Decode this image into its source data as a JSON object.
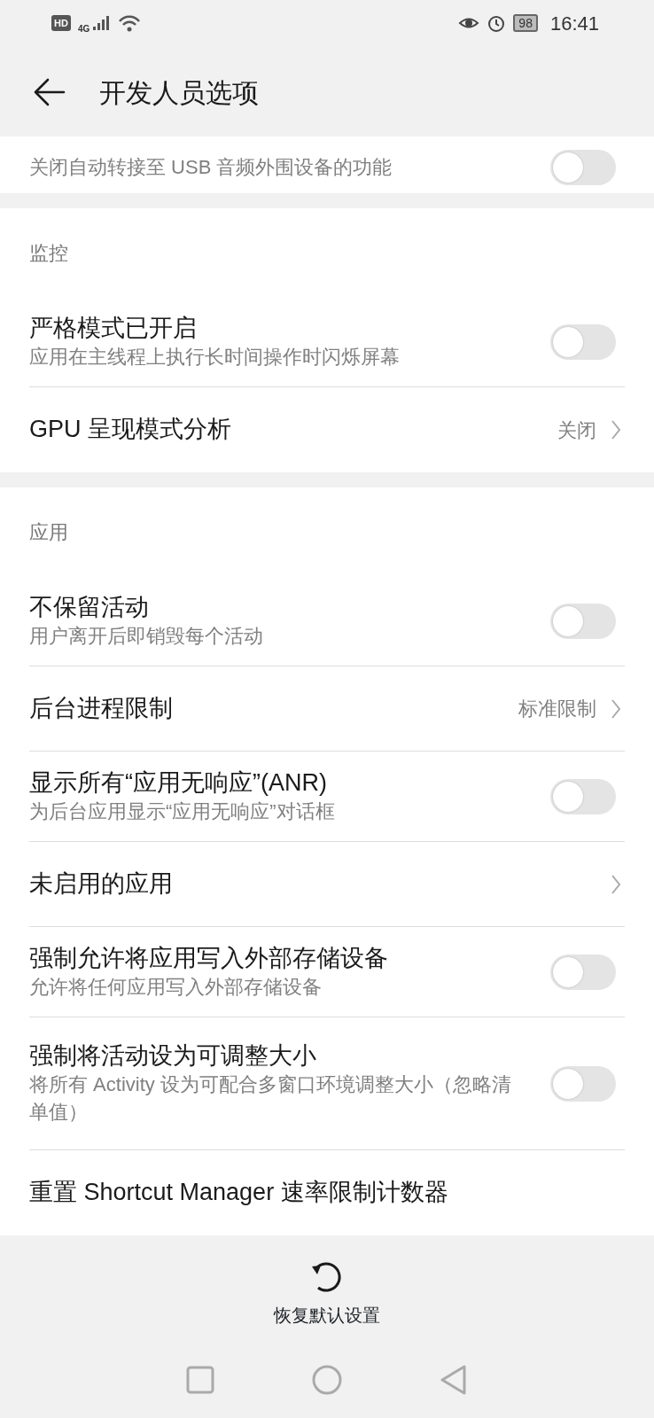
{
  "status_bar": {
    "hd": "HD",
    "network": "4G",
    "battery": "98",
    "time": "16:41"
  },
  "header": {
    "title": "开发人员选项"
  },
  "sections": [
    {
      "items": [
        {
          "kind": "toggle",
          "subtitle": "关闭自动转接至 USB 音频外围设备的功能",
          "on": false
        }
      ]
    },
    {
      "heading": "监控",
      "items": [
        {
          "kind": "toggle",
          "title": "严格模式已开启",
          "subtitle": "应用在主线程上执行长时间操作时闪烁屏幕",
          "on": false
        },
        {
          "kind": "link",
          "title": "GPU 呈现模式分析",
          "value": "关闭"
        }
      ]
    },
    {
      "heading": "应用",
      "items": [
        {
          "kind": "toggle",
          "title": "不保留活动",
          "subtitle": "用户离开后即销毁每个活动",
          "on": false
        },
        {
          "kind": "link",
          "title": "后台进程限制",
          "value": "标准限制"
        },
        {
          "kind": "toggle",
          "title": "显示所有“应用无响应”(ANR)",
          "subtitle": "为后台应用显示“应用无响应”对话框",
          "on": false
        },
        {
          "kind": "link",
          "title": "未启用的应用"
        },
        {
          "kind": "toggle",
          "title": "强制允许将应用写入外部存储设备",
          "subtitle": "允许将任何应用写入外部存储设备",
          "on": false
        },
        {
          "kind": "toggle",
          "title": "强制将活动设为可调整大小",
          "subtitle": "将所有 Activity 设为可配合多窗口环境调整大小（忽略清单值）",
          "on": false
        },
        {
          "kind": "plain",
          "title": "重置 Shortcut Manager 速率限制计数器"
        }
      ]
    }
  ],
  "footer": {
    "action": "恢复默认设置"
  }
}
